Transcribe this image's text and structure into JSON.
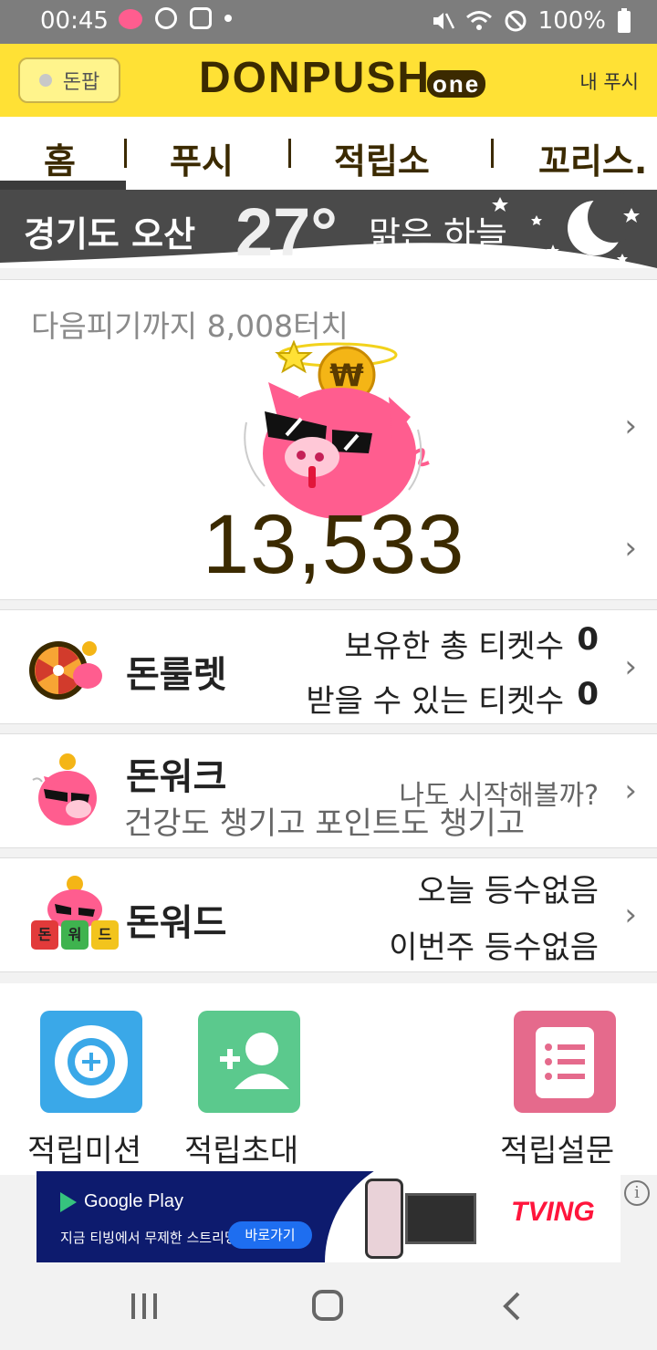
{
  "status_bar": {
    "time": "00:45",
    "battery": "100%",
    "icons": [
      "pig-app-icon",
      "q-app-icon",
      "gallery-icon",
      "dot-icon",
      "mute-icon",
      "wifi-icon",
      "block-icon",
      "battery-icon"
    ]
  },
  "header": {
    "donpop_label": "돈팝",
    "logo_text": "DONPUSH",
    "logo_sub": "one",
    "mypush_label": "내 푸시"
  },
  "tabs": [
    {
      "label": "홈"
    },
    {
      "label": "푸시"
    },
    {
      "label": "적립소"
    },
    {
      "label": "꼬리스."
    }
  ],
  "weather": {
    "location": "경기도 오산",
    "temperature": "27°",
    "description": "맑은 하늘"
  },
  "piggy": {
    "next_text": "다음피기까지 8,008터치",
    "points": "13,533"
  },
  "roulette": {
    "title": "돈룰렛",
    "tickets_owned_label": "보유한 총 티켓수",
    "tickets_owned": "0",
    "tickets_available_label": "받을 수 있는 티켓수",
    "tickets_available": "0"
  },
  "walk": {
    "title": "돈워크",
    "subtitle": "건강도 챙기고 포인트도 챙기고",
    "cta": "나도 시작해볼까?"
  },
  "word": {
    "title": "돈워드",
    "today": "오늘 등수없음",
    "week": "이번주 등수없음",
    "tiles": [
      "돈",
      "워",
      "드"
    ]
  },
  "actions": [
    {
      "label": "적립미션"
    },
    {
      "label": "적립초대"
    },
    {
      "label": "적립설문"
    }
  ],
  "ad": {
    "store": "Google Play",
    "text": "지금 티빙에서 무제한 스트리밍",
    "button": "바로가기",
    "brand": "TVING",
    "info": "i"
  },
  "colors": {
    "header_yellow": "#ffe135",
    "brand_brown": "#3b2a00",
    "pig_pink": "#ff5d8f",
    "mission_blue": "#3aa8e8",
    "invite_green": "#5bc98d",
    "survey_pink": "#e56a8c"
  }
}
